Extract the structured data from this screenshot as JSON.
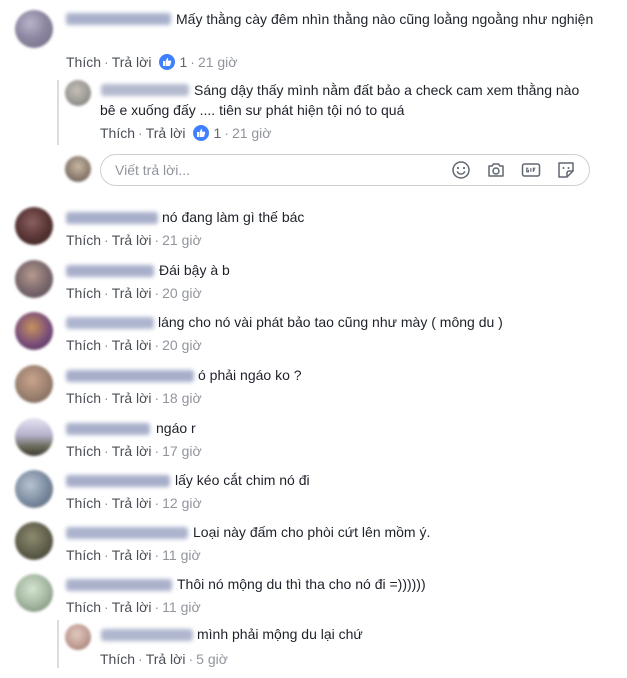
{
  "ui": {
    "like_label": "Thích",
    "reply_label": "Trả lời",
    "separator": "·",
    "reply_placeholder": "Viết trả lời..."
  },
  "colors": {
    "text": "#1d2129",
    "muted": "#90949c",
    "action": "#4b4f56",
    "like_blue": "#4080ff",
    "border": "#ccd0d5"
  },
  "comments": [
    {
      "text": "Mấy thằng cày đêm nhìn thằng nào cũng loằng ngoằng như nghiện",
      "likes": "1",
      "time": "21 giờ"
    },
    {
      "text": "Sáng dậy thấy mình nằm đất bảo a check cam xem thằng nào bê e xuống đấy .... tiên sư phát hiện tội nó to quá",
      "likes": "1",
      "time": "21 giờ"
    },
    {
      "text": "nó đang làm gì thế bác",
      "time": "21 giờ"
    },
    {
      "text": "Đái bậy à b",
      "time": "20 giờ"
    },
    {
      "text": "láng cho nó vài phát bảo tao cũng như mày ( mông du )",
      "time": "20 giờ"
    },
    {
      "text": "ó phải ngáo ko ?",
      "time": "18 giờ"
    },
    {
      "text": "ngáo r",
      "time": "17 giờ"
    },
    {
      "text": "lấy kéo cắt chim nó đi",
      "time": "12 giờ"
    },
    {
      "text": "Loại này đấm cho phòi cứt lên mồm ý.",
      "time": "11 giờ"
    },
    {
      "text": "Thôi nó mộng du thì tha cho nó đi =))))))",
      "time": "11 giờ"
    },
    {
      "text": "mình phải mộng du lại chứ",
      "time": "5 giờ"
    }
  ],
  "reply_tools": [
    "emoji-icon",
    "camera-icon",
    "gif-icon",
    "sticker-icon"
  ]
}
